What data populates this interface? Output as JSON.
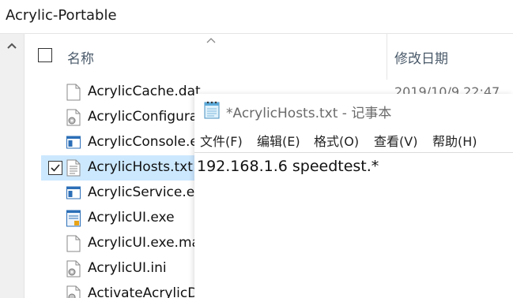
{
  "explorer": {
    "title": "Acrylic-Portable",
    "header": {
      "name_label": "名称",
      "date_label": "修改日期"
    },
    "files": [
      {
        "name": "AcrylicCache.dat",
        "date": "2019/10/9 22:47",
        "icon": "blank-file-icon",
        "checked": false,
        "selected": false
      },
      {
        "name": "AcrylicConfigura",
        "date": "",
        "icon": "config-file-icon",
        "checked": false,
        "selected": false
      },
      {
        "name": "AcrylicConsole.e",
        "date": "",
        "icon": "app-window-icon",
        "checked": false,
        "selected": false
      },
      {
        "name": "AcrylicHosts.txt",
        "date": "",
        "icon": "text-file-icon",
        "checked": true,
        "selected": true
      },
      {
        "name": "AcrylicService.ex",
        "date": "",
        "icon": "app-window-icon",
        "checked": false,
        "selected": false
      },
      {
        "name": "AcrylicUI.exe",
        "date": "",
        "icon": "app-ui-icon",
        "checked": false,
        "selected": false
      },
      {
        "name": "AcrylicUI.exe.ma",
        "date": "",
        "icon": "blank-file-icon",
        "checked": false,
        "selected": false
      },
      {
        "name": "AcrylicUI.ini",
        "date": "",
        "icon": "config-file-icon",
        "checked": false,
        "selected": false
      },
      {
        "name": "ActivateAcrylicD",
        "date": "",
        "icon": "script-file-icon",
        "checked": false,
        "selected": false
      }
    ]
  },
  "notepad": {
    "title": "*AcrylicHosts.txt - 记事本",
    "menu": [
      "文件(F)",
      "编辑(E)",
      "格式(O)",
      "查看(V)",
      "帮助(H)"
    ],
    "content": "192.168.1.6 speedtest.*"
  },
  "colors": {
    "selection": "#cce8ff",
    "header_text": "#4a5a6a"
  }
}
